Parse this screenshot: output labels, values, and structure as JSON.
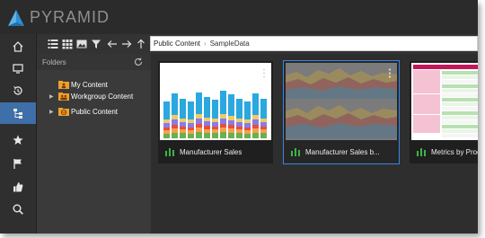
{
  "app": {
    "title": "PYRAMID"
  },
  "colors": {
    "accent": "#3f6fa8",
    "selection": "#3a86e0",
    "chartIconGreen": "#39b54a",
    "folderOrange": "#f0a02a"
  },
  "rail": {
    "items": [
      {
        "name": "home-icon"
      },
      {
        "name": "monitor-icon"
      },
      {
        "name": "history-icon"
      },
      {
        "name": "content-tree-icon",
        "active": true
      },
      {
        "name": "star-icon"
      },
      {
        "name": "flag-icon"
      },
      {
        "name": "thumbs-up-icon"
      },
      {
        "name": "search-icon"
      }
    ]
  },
  "toolbar": {
    "icons": [
      "list-view-icon",
      "grid-view-icon",
      "image-view-icon",
      "filter-icon",
      "back-arrow-icon",
      "forward-arrow-icon",
      "up-arrow-icon"
    ],
    "breadcrumb": [
      "Public Content",
      "SampleData"
    ]
  },
  "folders": {
    "title": "Folders",
    "items": [
      {
        "label": "My Content",
        "expandable": false
      },
      {
        "label": "Workgroup Content",
        "expandable": true
      },
      {
        "label": "Public Content",
        "expandable": true
      }
    ]
  },
  "cards": [
    {
      "label": "Manufacturer Sales",
      "selected": false
    },
    {
      "label": "Manufacturer Sales b...",
      "selected": true
    },
    {
      "label": "Metrics by Produ",
      "selected": false
    }
  ]
}
